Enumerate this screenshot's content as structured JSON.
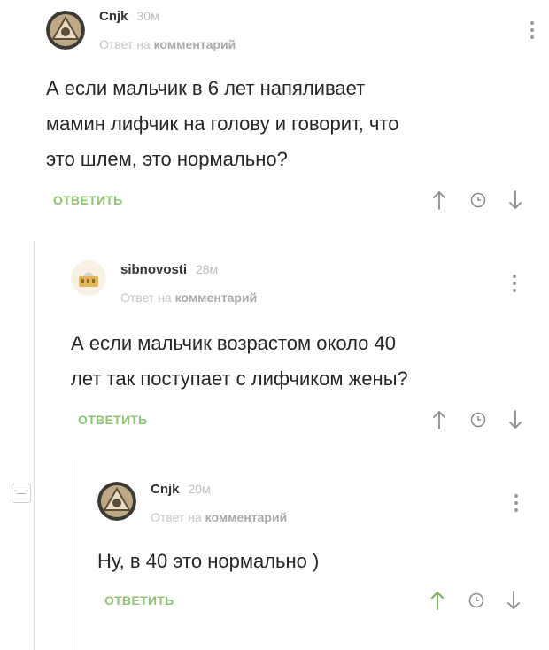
{
  "comments": [
    {
      "author": "Cnjk",
      "time": "30м",
      "reply_prefix": "Ответ на ",
      "reply_target": "комментарий",
      "lines": [
        "А если мальчик в 6 лет напяливает",
        "мамин лифчик на голову и говорит, что",
        "это шлем, это нормально?"
      ],
      "reply_button": "ОТВЕТИТЬ",
      "avatar_icon": "triangle-avatar-icon"
    },
    {
      "author": "sibnovosti",
      "time": "28м",
      "reply_prefix": "Ответ на ",
      "reply_target": "комментарий",
      "lines": [
        "А если мальчик возрастом около 40",
        "лет так поступает с лифчиком жены?"
      ],
      "reply_button": "ОТВЕТИТЬ",
      "avatar_icon": "building-avatar-icon"
    },
    {
      "author": "Cnjk",
      "time": "20м",
      "reply_prefix": "Ответ на ",
      "reply_target": "комментарий",
      "lines": [
        "Ну, в 40 это нормально )"
      ],
      "reply_button": "ОТВЕТИТЬ",
      "avatar_icon": "triangle-avatar-icon"
    }
  ],
  "colors": {
    "reply_green": "#8fc177",
    "arrow_up_active": "#7bb35d",
    "icon_gray": "#8a8a8a"
  },
  "icons": [
    "more-vertical-icon",
    "arrow-up-icon",
    "clock-icon",
    "arrow-down-icon",
    "collapse-minus-icon"
  ]
}
